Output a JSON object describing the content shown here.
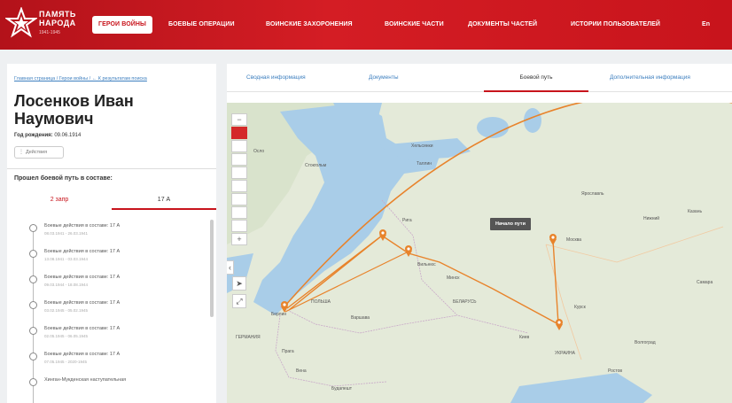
{
  "header": {
    "logo_line1": "ПАМЯТЬ",
    "logo_line2": "НАРОДА",
    "logo_sub": "1941-1945",
    "nav": [
      {
        "label": "ГЕРОИ ВОЙНЫ",
        "active": true
      },
      {
        "label": "БОЕВЫЕ ОПЕРАЦИИ"
      },
      {
        "label": "ВОИНСКИЕ ЗАХОРОНЕНИЯ"
      },
      {
        "label": "ВОИНСКИЕ ЧАСТИ"
      },
      {
        "label": "ДОКУМЕНТЫ ЧАСТЕЙ"
      },
      {
        "label": "ИСТОРИИ ПОЛЬЗОВАТЕЛЕЙ"
      },
      {
        "label": "En"
      }
    ]
  },
  "left": {
    "breadcrumb": "Главная страница / Герои войны / ← К результатам поиска",
    "name_line1": "Лосенков Иван",
    "name_line2": "Наумович",
    "birth_label": "Год рождения:",
    "birth_value": "09.06.1914",
    "actions_label": "Действия",
    "path_title": "Прошел боевой путь в составе:",
    "tabs": [
      "2 запр",
      "17 А"
    ],
    "timeline": [
      {
        "title": "Боевые действия в составе: 17 А",
        "date": "08.03.1941 - 26.03.1941"
      },
      {
        "title": "Боевые действия в составе: 17 А",
        "date": "13.08.1941 - 03.03.1944"
      },
      {
        "title": "Боевые действия в составе: 17 А",
        "date": "09.03.1944 - 18.08.1944"
      },
      {
        "title": "Боевые действия в составе: 17 А",
        "date": "03.02.1945 - 05.02.1945"
      },
      {
        "title": "Боевые действия в составе: 17 А",
        "date": "02.05.1945 - 06.05.1945"
      },
      {
        "title": "Боевые действия в составе: 17 А",
        "date": "07.05.1945 - 2020-1945"
      },
      {
        "title": "Хинган-Мукденская наступательная",
        "date": ""
      }
    ]
  },
  "right": {
    "tabs": [
      {
        "label": "Сводная информация"
      },
      {
        "label": "Документы"
      },
      {
        "label": "Боевой путь",
        "active": true
      },
      {
        "label": "Дополнительная информация"
      }
    ],
    "map": {
      "start_label": "Начало пути",
      "labels": {
        "moskva": "Москва",
        "tallinn": "Таллин",
        "helsinki": "Хельсинки",
        "stockholm": "Стокгольм",
        "oslo": "Осло",
        "berlin": "Берлин",
        "varshava": "Варшава",
        "praga": "Прага",
        "belarus": "БЕЛАРУСЬ",
        "polsha": "ПОЛЬША",
        "germania": "ГЕРМАНИЯ",
        "budapesht": "Будапешт",
        "vena": "Вена",
        "ukraina": "УКРАИНА",
        "minsk": "Минск",
        "vilnyus": "Вильнюс",
        "riga": "Рига",
        "kursk": "Курск",
        "volgograd": "Волгоград",
        "rostov": "Ростов",
        "kiev": "Киев",
        "kazan": "Казань",
        "samara": "Самара",
        "yaroslavl": "Ярославль",
        "niznhy": "Нижний"
      }
    }
  },
  "colors": {
    "brand_red": "#c8141c",
    "route": "#e8832b",
    "link": "#3d7fbf"
  }
}
